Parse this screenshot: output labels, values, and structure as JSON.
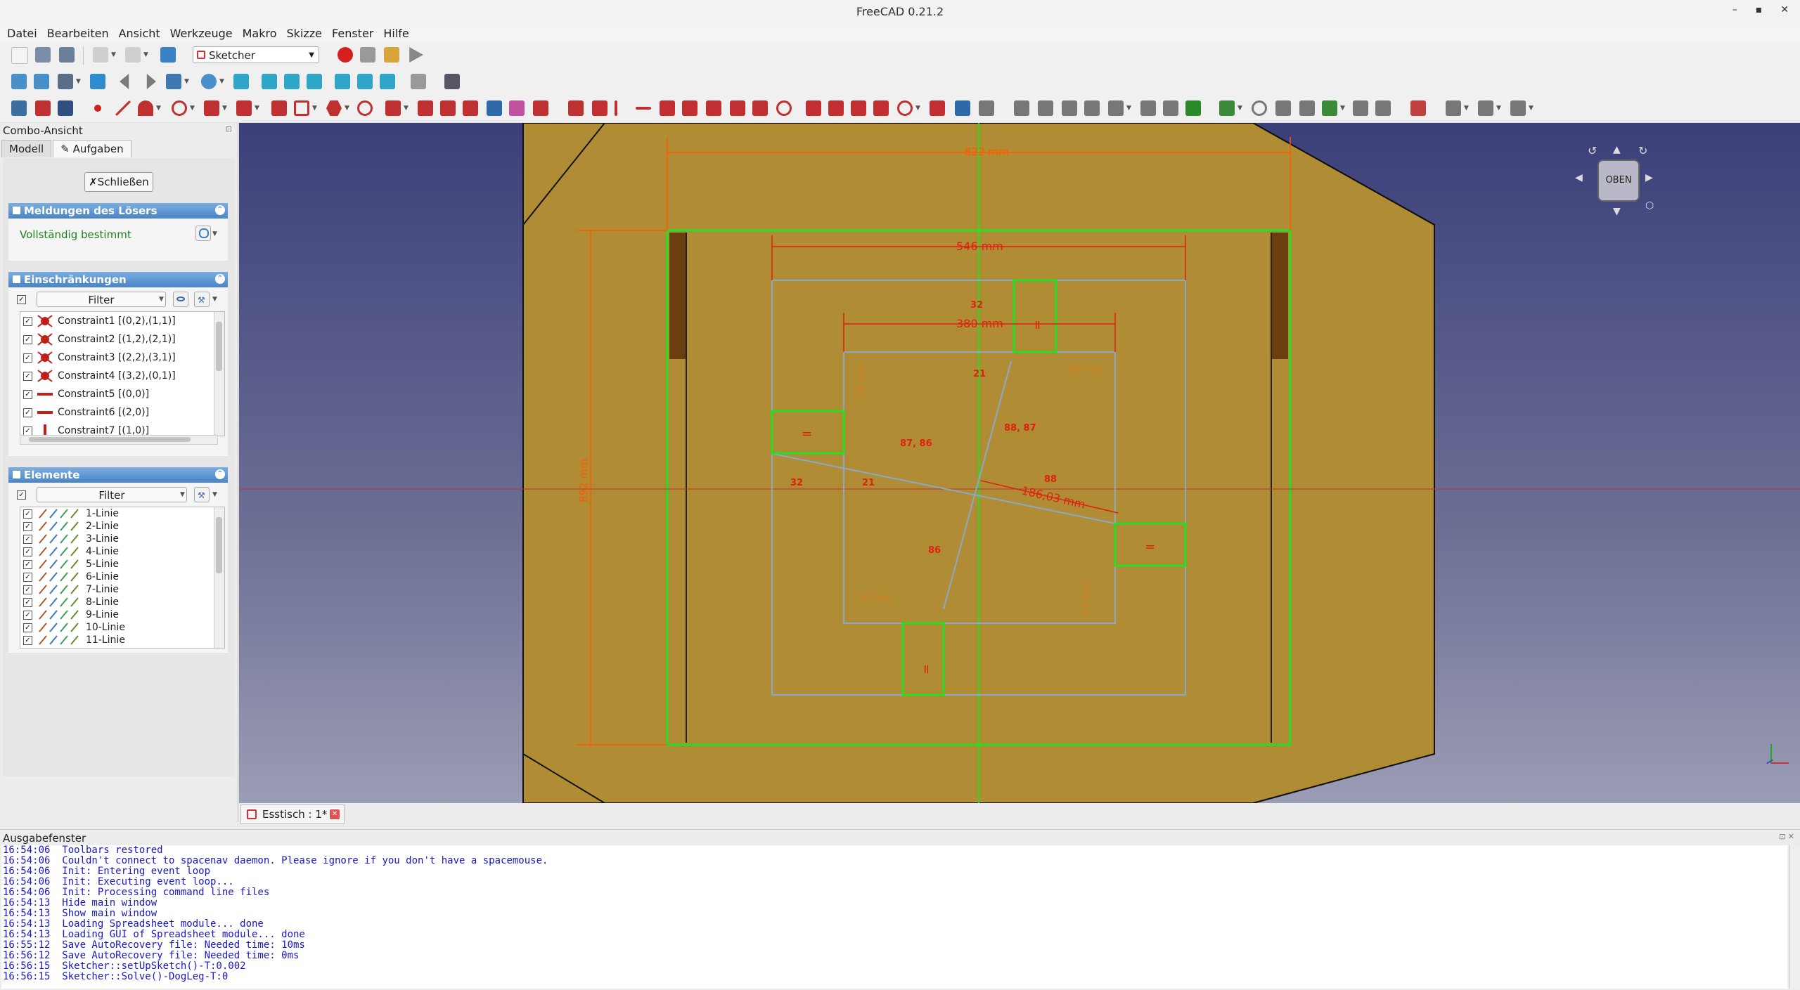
{
  "window": {
    "title": "FreeCAD 0.21.2",
    "min": "–",
    "max": "▪",
    "close": "✕"
  },
  "menu": [
    "Datei",
    "Bearbeiten",
    "Ansicht",
    "Werkzeuge",
    "Makro",
    "Skizze",
    "Fenster",
    "Hilfe"
  ],
  "workbench": "Sketcher",
  "combo": {
    "title": "Combo-Ansicht",
    "tabs": [
      "Modell",
      "Aufgaben"
    ],
    "close_button": "Schließen",
    "solver": {
      "header": "Meldungen des Lösers",
      "status": "Vollständig bestimmt"
    },
    "constraints": {
      "header": "Einschränkungen",
      "filter": "Filter",
      "items": [
        "Constraint1 [(0,2),(1,1)]",
        "Constraint2 [(1,2),(2,1)]",
        "Constraint3 [(2,2),(3,1)]",
        "Constraint4 [(3,2),(0,1)]",
        "Constraint5 [(0,0)]",
        "Constraint6 [(2,0)]",
        "Constraint7 [(1,0)]"
      ]
    },
    "elements": {
      "header": "Elemente",
      "filter": "Filter",
      "items": [
        "1-Linie",
        "2-Linie",
        "3-Linie",
        "4-Linie",
        "5-Linie",
        "6-Linie",
        "7-Linie",
        "8-Linie",
        "9-Linie",
        "10-Linie",
        "11-Linie"
      ]
    }
  },
  "sketch": {
    "dims": {
      "top": "822 mm",
      "left": "892 mm",
      "outer_inner": "546 mm",
      "inner": "380 mm",
      "diag": "186,03 mm",
      "sq_a": "54 mm",
      "sq_b": "54 mm",
      "sq_c": "54 mm",
      "sq_d": "54 mm"
    },
    "angles": {
      "a1": "87, 86",
      "a2": "88, 87",
      "a3": "88",
      "a4": "86",
      "a5": "32",
      "a6": "32",
      "a7": "21",
      "a8": "21"
    },
    "eq": "=",
    "nav_label": "OBEN",
    "colors": {
      "wood": "#b08d35",
      "green": "#22e022",
      "constraint": "#e02010",
      "geom": "#8aa8c8"
    }
  },
  "doc_tab": "Esstisch : 1*",
  "output": {
    "title": "Ausgabefenster",
    "lines": [
      "16:54:06  Toolbars restored",
      "16:54:06  Couldn't connect to spacenav daemon. Please ignore if you don't have a spacemouse.",
      "16:54:06  Init: Entering event loop",
      "16:54:06  Init: Executing event loop...",
      "16:54:06  Init: Processing command line files",
      "16:54:13  Hide main window",
      "16:54:13  Show main window",
      "16:54:13  Loading Spreadsheet module... done",
      "16:54:13  Loading GUI of Spreadsheet module... done",
      "16:55:12  Save AutoRecovery file: Needed time: 10ms",
      "16:56:12  Save AutoRecovery file: Needed time: 0ms",
      "16:56:15  Sketcher::setUpSketch()-T:0.002",
      "16:56:15  Sketcher::Solve()-DogLeg-T:0"
    ]
  }
}
